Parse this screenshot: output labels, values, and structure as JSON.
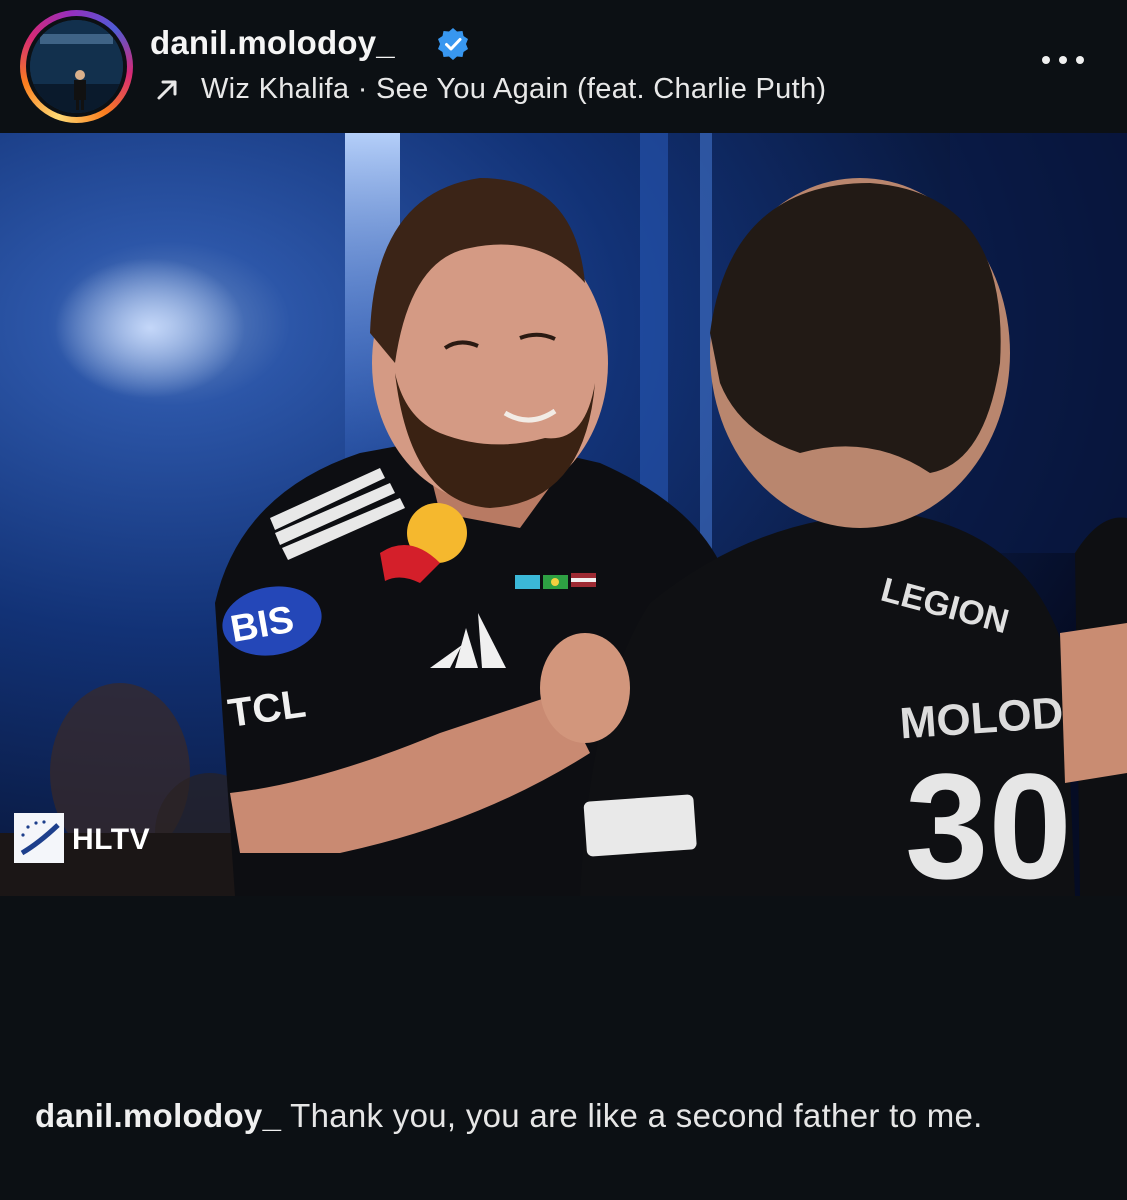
{
  "post": {
    "username": "danil.molodoy_",
    "verified": true,
    "music": "Wiz Khalifa · See You Again (feat. Charlie Puth)",
    "menu_icon": "more-horizontal-icon",
    "music_icon": "arrow-up-right-icon"
  },
  "photo": {
    "watermark": "HLTV",
    "jersey_texts": [
      "BIS",
      "TCL",
      "LEGION",
      "MOLODOY"
    ]
  },
  "caption": {
    "username": "danil.molodoy_",
    "text": "Thank you, you are like a second father to me."
  },
  "colors": {
    "background": "#0c1014",
    "verified_badge": "#3897f0",
    "stage_blue": "#1b4fb0"
  }
}
